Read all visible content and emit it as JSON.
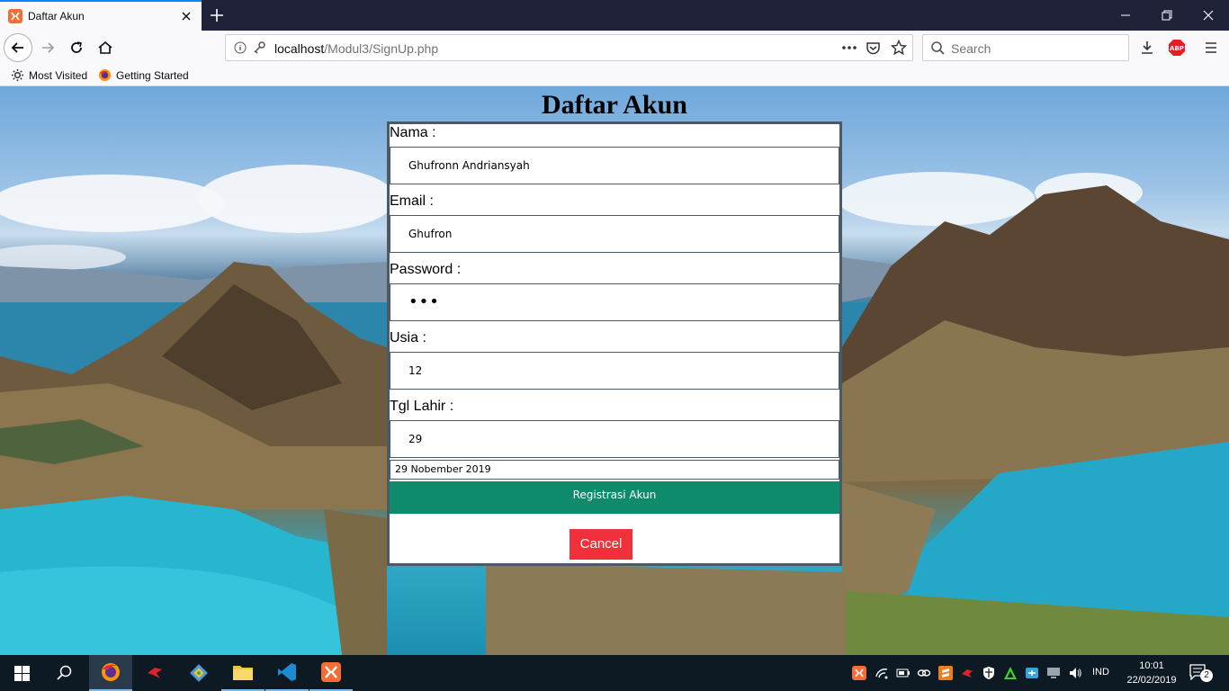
{
  "browser": {
    "tab_title": "Daftar Akun",
    "url_host": "localhost",
    "url_path": "/Modul3/SignUp.php",
    "search_placeholder": "Search",
    "bookmarks": [
      {
        "label": "Most Visited",
        "icon": "gear-icon"
      },
      {
        "label": "Getting Started",
        "icon": "firefox-icon"
      }
    ]
  },
  "page": {
    "title": "Daftar Akun",
    "fields": [
      {
        "label": "Nama :",
        "value": "Ghufronn Andriansyah"
      },
      {
        "label": "Email :",
        "value": "Ghufron"
      },
      {
        "label": "Password :",
        "value": "•••"
      },
      {
        "label": "Usia :",
        "value": "12"
      },
      {
        "label": "Tgl Lahir :",
        "value": "29"
      }
    ],
    "date_value": "29 Nobember 2019",
    "register_label": "Registrasi Akun",
    "cancel_label": "Cancel"
  },
  "taskbar": {
    "language": "IND",
    "time": "10:01",
    "date": "22/02/2019",
    "notifications": "2"
  },
  "colors": {
    "register_bg": "#0e8b6a",
    "cancel_bg": "#f0303a",
    "tab_accent": "#0a84ff"
  }
}
